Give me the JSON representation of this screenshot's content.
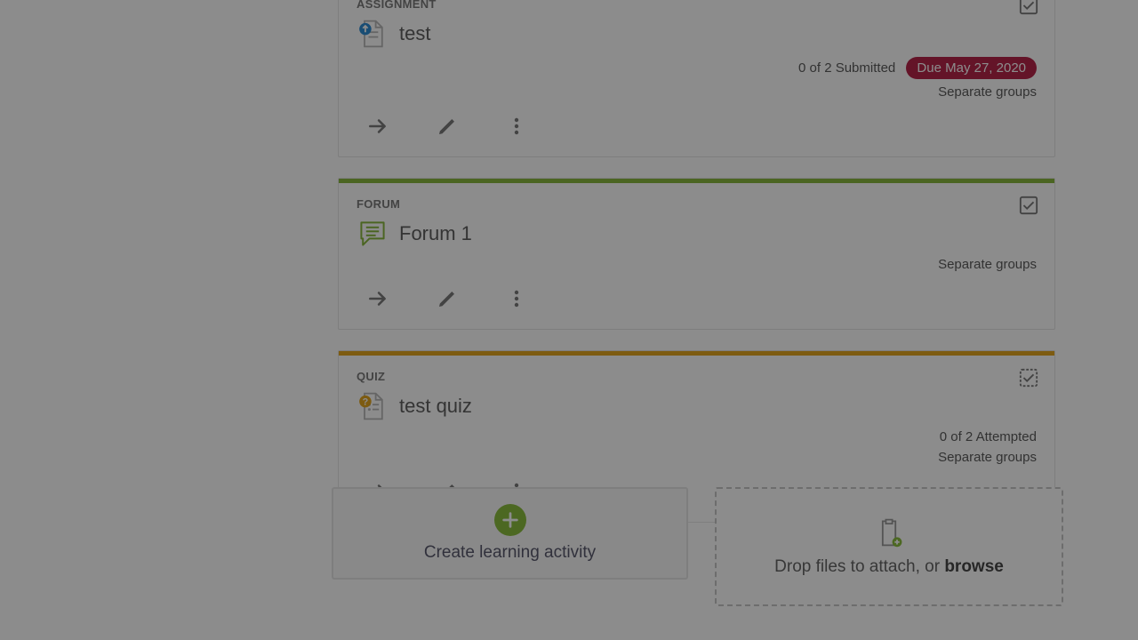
{
  "cards": [
    {
      "type_label": "ASSIGNMENT",
      "title": "test",
      "topbar": "blue",
      "submitted": "0 of 2 Submitted",
      "due": "Due May 27, 2020",
      "groups": "Separate groups"
    },
    {
      "type_label": "FORUM",
      "title": "Forum 1",
      "topbar": "green",
      "groups": "Separate groups"
    },
    {
      "type_label": "QUIZ",
      "title": "test quiz",
      "topbar": "orange",
      "attempted": "0 of 2 Attempted",
      "groups": "Separate groups"
    }
  ],
  "create_label": "Create learning activity",
  "drop_prefix": "Drop files to attach, or ",
  "drop_browse": "browse",
  "colors": {
    "due_pill": "#b7264a",
    "green_accent": "#8bbd3f"
  }
}
